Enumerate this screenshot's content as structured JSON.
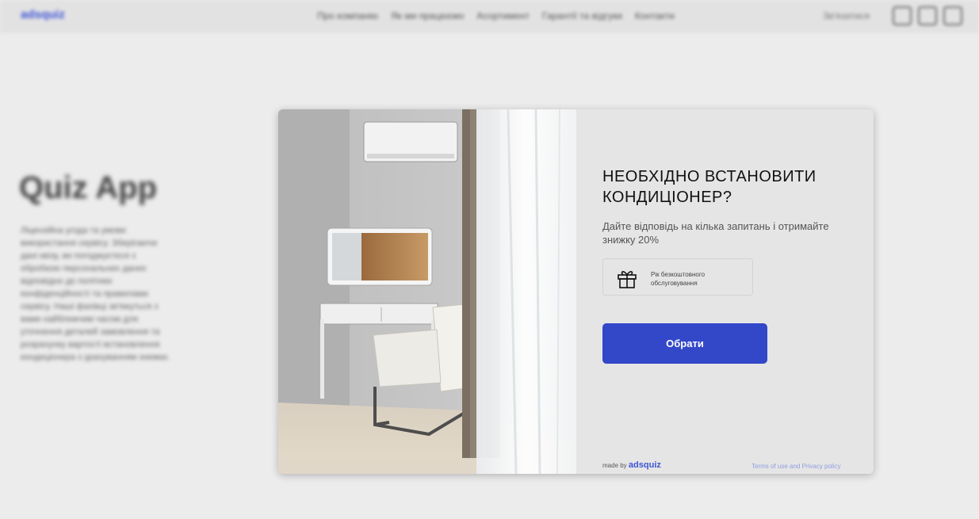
{
  "background_page": {
    "logo": "adsquiz",
    "nav": [
      "Про компанію",
      "Як ми працюємо",
      "Асортимент",
      "Гарантії та відгуки",
      "Контакти"
    ],
    "contact": "Зв'язатися",
    "title": "Quiz App",
    "text": "Ліцензійна угода та умови використання сервісу. Зберігаючи дані квізу, ви погоджуєтеся з обробкою персональних даних відповідно до політики конфіденційності та правилами сервісу. Наші фахівці зв'яжуться з вами найближчим часом для уточнення деталей замовлення та розрахунку вартості встановлення кондиціонера з урахуванням знижки."
  },
  "quiz": {
    "headline": "НЕОБХІДНО ВСТАНОВИТИ КОНДИЦІОНЕР?",
    "subtitle": "Дайте відповідь на кілька запитань і отримайте знижку 20%",
    "bonus": {
      "icon": "gift-icon",
      "text": "Рік безкоштовного обслуговування"
    },
    "cta_label": "Обрати",
    "made_by_prefix": "made by",
    "made_by_brand": "adsquiz",
    "terms": "Terms of use and Privacy policy",
    "accent_color": "#3347c9"
  }
}
